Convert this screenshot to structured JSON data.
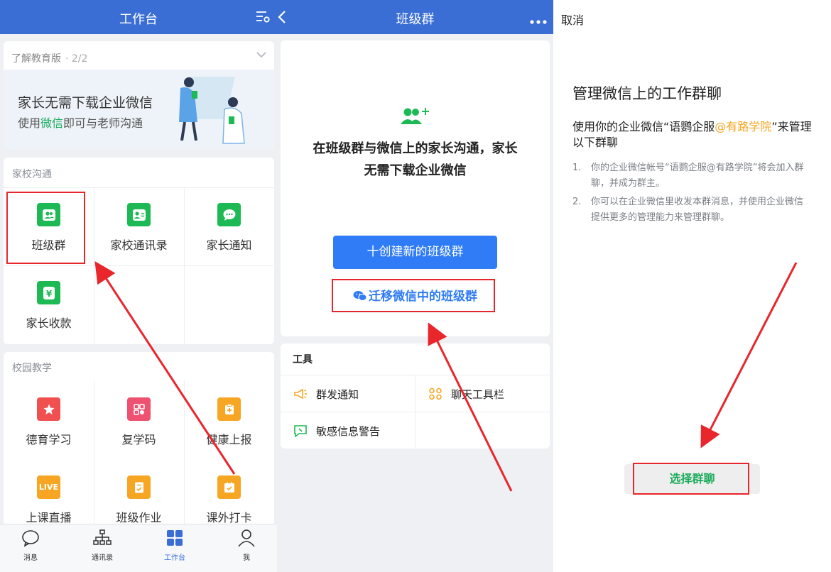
{
  "panel1": {
    "title": "工作台",
    "banner": {
      "heading": "了解教育版",
      "page": "· 2/2",
      "line1": "家长无需下载企业微信",
      "line2_pre": "使用",
      "line2_hl": "微信",
      "line2_post": "即可与老师沟通"
    },
    "home_section": {
      "title": "家校沟通",
      "items": [
        "班级群",
        "家校通讯录",
        "家长通知",
        "家长收款"
      ]
    },
    "campus_section": {
      "title": "校园教学",
      "items": [
        "德育学习",
        "复学码",
        "健康上报",
        "上课直播",
        "班级作业",
        "课外打卡"
      ],
      "live_badge": "LIVE"
    },
    "tabs": [
      {
        "label": "消息",
        "icon": "chat-bubble-icon"
      },
      {
        "label": "通讯录",
        "icon": "org-chart-icon"
      },
      {
        "label": "工作台",
        "icon": "grid-icon"
      },
      {
        "label": "我",
        "icon": "person-icon"
      }
    ]
  },
  "panel2": {
    "title": "班级群",
    "description": "在班级群与微信上的家长沟通，家长无需下载企业微信",
    "create_button": "十创建新的班级群",
    "migrate_button": "迁移微信中的班级群",
    "tools_title": "工具",
    "tools": [
      "群发通知",
      "聊天工具栏",
      "敏感信息警告"
    ]
  },
  "panel3": {
    "cancel": "取消",
    "heading": "管理微信上的工作群聊",
    "sub_pre": "使用你的企业微信“语鹦企服",
    "sub_org": "@有路学院",
    "sub_post": "”来管理以下群聊",
    "list": [
      {
        "num": "1.",
        "text": "你的企业微信帐号“语鹦企服@有路学院”将会加入群聊，并成为群主。"
      },
      {
        "num": "2.",
        "text": "你可以在企业微信里收发本群消息，并使用企业微信提供更多的管理能力来管理群聊。"
      }
    ],
    "choose_button": "选择群聊"
  },
  "colors": {
    "header_blue": "#3a6ed4",
    "primary_blue": "#2f7cf6",
    "wechat_green": "#1aab5b",
    "annotation_red": "#e8262c",
    "org_orange": "#f6a623"
  }
}
